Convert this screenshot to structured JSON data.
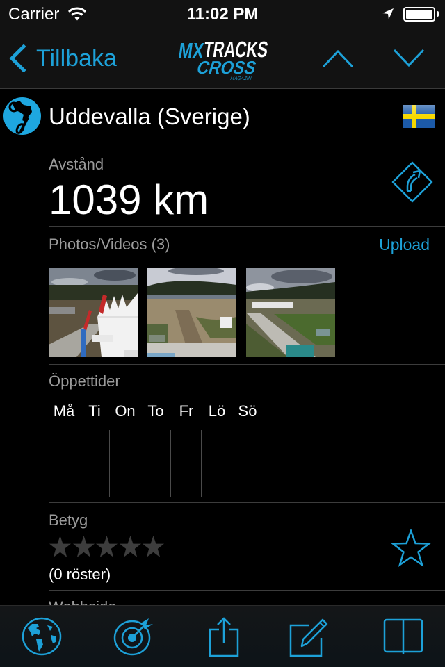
{
  "status_bar": {
    "carrier": "Carrier",
    "time": "11:02 PM",
    "battery_level": 1.0
  },
  "nav": {
    "back_label": "Tillbaka",
    "logo": {
      "line1_a": "MX",
      "line1_b": "TRACKS",
      "line2": "CROSS",
      "line3": "MAGAZIN"
    },
    "previous_icon": "chevron-up-icon",
    "next_icon": "chevron-down-icon"
  },
  "track": {
    "name": "Uddevalla (Sverige)",
    "country_flag": "sweden-flag"
  },
  "distance": {
    "label": "Avstånd",
    "value": "1039 km",
    "action_icon": "directions-icon"
  },
  "media": {
    "label": "Photos/Videos (3)",
    "upload_label": "Upload",
    "photos": [
      {
        "description": "Track overview with white tents and red Yamaha banners"
      },
      {
        "description": "Dirt track jumps with forest background"
      },
      {
        "description": "Paddock area with road and blue toilets"
      }
    ]
  },
  "hours": {
    "label": "Öppettider",
    "days": [
      "Må",
      "Ti",
      "On",
      "To",
      "Fr",
      "Lö",
      "Sö"
    ]
  },
  "rating": {
    "label": "Betyg",
    "stars_filled": 0,
    "stars_total": 5,
    "votes_text": "(0 röster)",
    "favorite_icon": "star-outline-icon"
  },
  "website": {
    "label": "Webbsida"
  },
  "tabbar": {
    "items": [
      {
        "name": "map",
        "icon": "globe-icon"
      },
      {
        "name": "nearby",
        "icon": "target-icon"
      },
      {
        "name": "share",
        "icon": "share-icon"
      },
      {
        "name": "edit",
        "icon": "edit-icon"
      },
      {
        "name": "guide",
        "icon": "book-icon"
      }
    ]
  },
  "colors": {
    "accent": "#1da1d8",
    "bar_bg": "#121212",
    "label_gray": "#9b9b9b",
    "separator": "#3c3c3c"
  }
}
